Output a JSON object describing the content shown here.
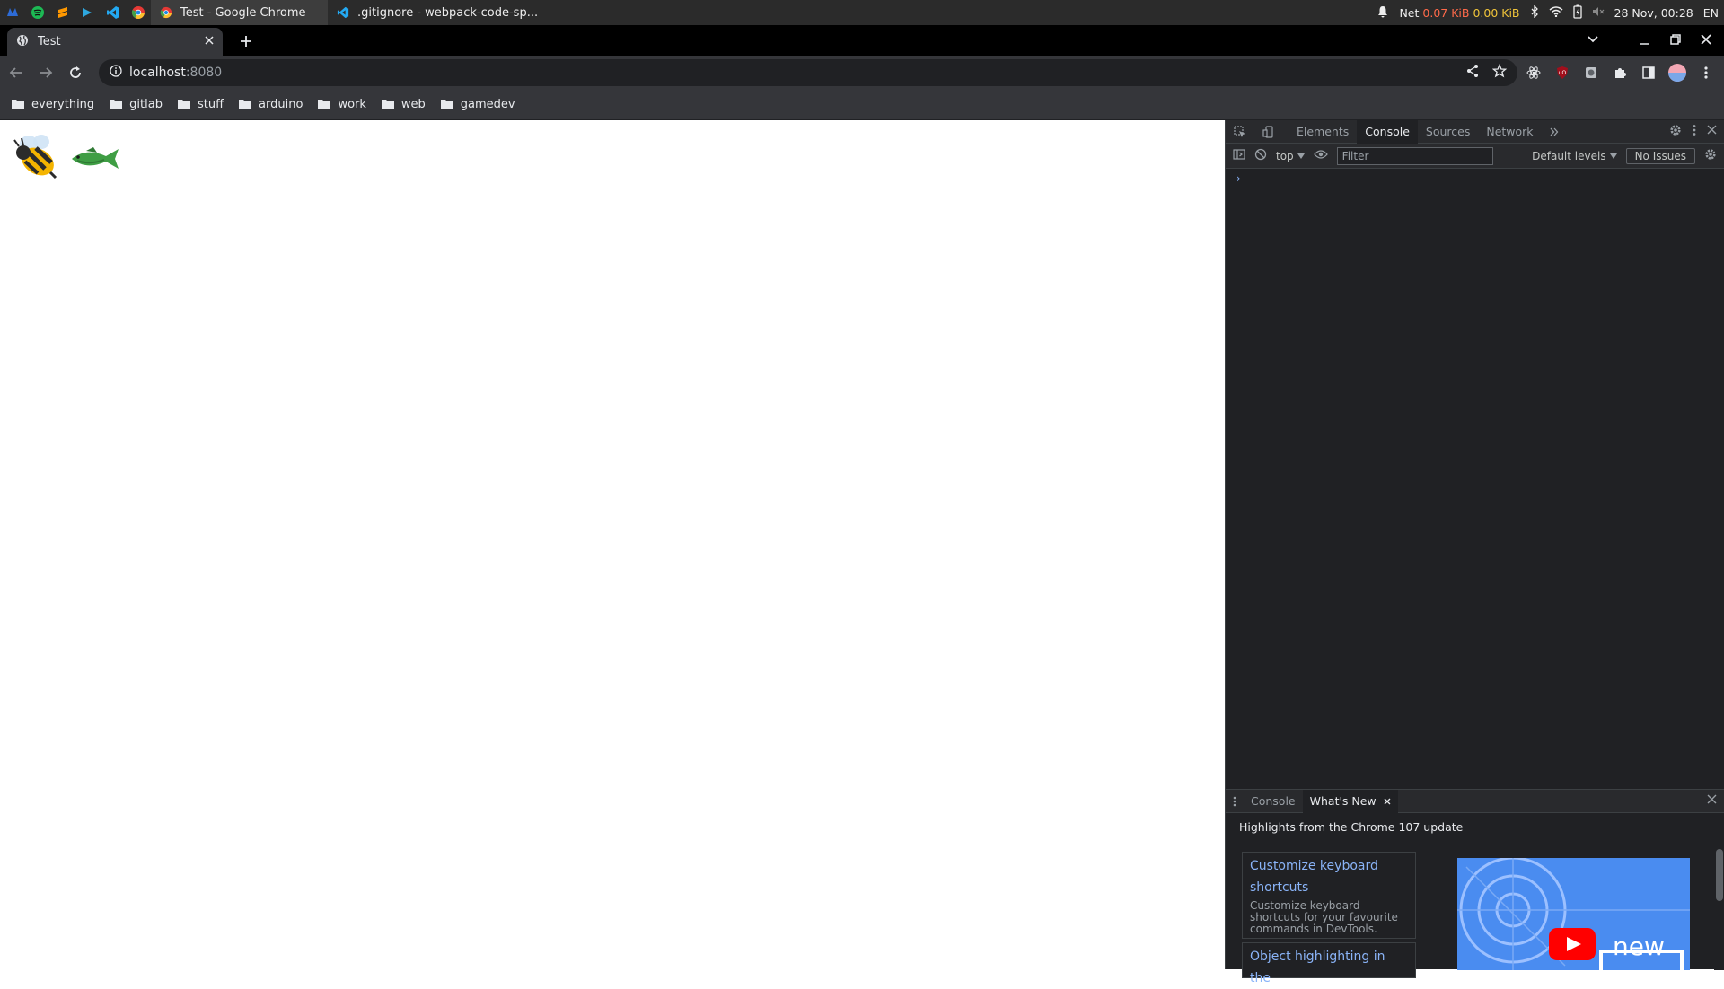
{
  "taskbar": {
    "apps": [
      {
        "name": "app-menu-icon",
        "color": "#2d6bd6"
      },
      {
        "name": "spotify-icon",
        "color": "#1db954"
      },
      {
        "name": "sublime-icon",
        "color": "#ff9800"
      },
      {
        "name": "terminal-icon",
        "color": "#2ea8e0"
      },
      {
        "name": "vscode-icon",
        "color": "#23a9f2"
      },
      {
        "name": "chrome-icon",
        "color": "#e53935"
      }
    ],
    "windows": [
      {
        "title": "Test - Google Chrome",
        "icon": "chrome-icon"
      },
      {
        "title": ".gitignore - webpack-code-sp...",
        "icon": "vscode-icon"
      }
    ],
    "tray": {
      "net_label": "Net",
      "net_up": "0.07 KiB",
      "net_down": "0.00 KiB",
      "datetime": "28 Nov, 00:28",
      "lang": "EN"
    }
  },
  "browser": {
    "tab_title": "Test",
    "url_host": "localhost",
    "url_port": ":8080",
    "bookmarks": [
      "everything",
      "gitlab",
      "stuff",
      "arduino",
      "work",
      "web",
      "gamedev"
    ]
  },
  "page": {
    "emojis": [
      {
        "name": "bee-emoji",
        "glyph": "🐝"
      },
      {
        "name": "fish-emoji",
        "glyph": "🐟"
      }
    ]
  },
  "devtools": {
    "tabs": [
      "Elements",
      "Console",
      "Sources",
      "Network"
    ],
    "active_tab": "Console",
    "context": "top",
    "filter_placeholder": "Filter",
    "levels": "Default levels",
    "issues": "No Issues",
    "prompt": "›",
    "drawer": {
      "tabs": [
        "Console",
        "What's New"
      ],
      "active_tab": "What's New",
      "heading": "Highlights from the Chrome 107 update",
      "cards": [
        {
          "title": "Customize keyboard shortcuts",
          "desc": "Customize keyboard shortcuts for your favourite commands in DevTools."
        },
        {
          "title": "Object highlighting in the"
        }
      ],
      "video_caption": "new"
    }
  }
}
